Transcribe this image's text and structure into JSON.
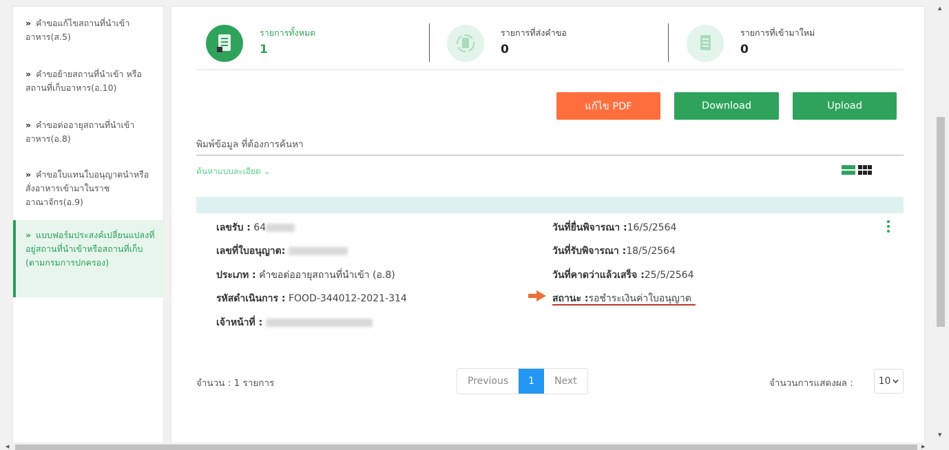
{
  "sidebar": {
    "chevron": "»",
    "items": [
      {
        "label": "คำขอแก้ไขสถานที่นำเข้าอาหาร(ส.5)"
      },
      {
        "label": "คำขอย้ายสถานที่นำเข้า หรือสถานที่เก็บอาหาร(อ.10)"
      },
      {
        "label": "คำขอต่ออายุสถานที่นำเข้าอาหาร(อ.8)"
      },
      {
        "label": "คำขอใบแทนใบอนุญาตนำหรือสั่งอาหารเข้ามาในราชอาณาจักร(อ.9)"
      },
      {
        "label": "แบบฟอร์มประสงค์เปลี่ยนแปลงที่อยู่สถานที่นำเข้าหรือสถานที่เก็บ (ตามกรมการปกครอง)"
      }
    ]
  },
  "stats": [
    {
      "label": "รายการทั้งหมด",
      "value": "1",
      "icon": "document-icon",
      "color": "#2fa35c"
    },
    {
      "label": "รายการที่ส่งคำขอ",
      "value": "0",
      "icon": "refresh-document-icon",
      "color": "#e3f4ea"
    },
    {
      "label": "รายการที่เข้ามาใหม่",
      "value": "0",
      "icon": "new-document-icon",
      "color": "#e3f4ea"
    }
  ],
  "buttons": {
    "edit_pdf": "แก้ไข PDF",
    "download": "Download",
    "upload": "Upload"
  },
  "search": {
    "placeholder": "พิมพ์ข้อมูล ที่ต้องการค้นหา",
    "advanced": "ค้นหาแบบละเอียด ⌄"
  },
  "result": {
    "receipt_label": "เลขรับ :",
    "receipt_value": "64",
    "license_label": "เลขที่ใบอนุญาต:",
    "type_label": "ประเภท :",
    "type_value": "คำขอต่ออายุสถานที่นำเข้า (อ.8)",
    "op_code_label": "รหัสดำเนินการ :",
    "op_code_value": "FOOD-344012-2021-314",
    "officer_label": "เจ้าหน้าที่ :",
    "submit_date_label": "วันที่ยื่นพิจารณา :",
    "submit_date_value": "16/5/2564",
    "accept_date_label": "วันที่รับพิจารณา :",
    "accept_date_value": "18/5/2564",
    "expected_date_label": "วันที่คาดว่าแล้วเสร็จ :",
    "expected_date_value": "25/5/2564",
    "status_label": "สถานะ :",
    "status_value": "รอชำระเงินค่าใบอนุญาต"
  },
  "footer": {
    "total": "จำนวน : 1 รายการ",
    "previous": "Previous",
    "page": "1",
    "next": "Next",
    "perpage_label": "จำนวนการแสดงผล :",
    "perpage_value": "10"
  },
  "colors": {
    "accent": "#2fa35c",
    "orange": "#ff6e3d",
    "status_underline": "#c0392b"
  }
}
